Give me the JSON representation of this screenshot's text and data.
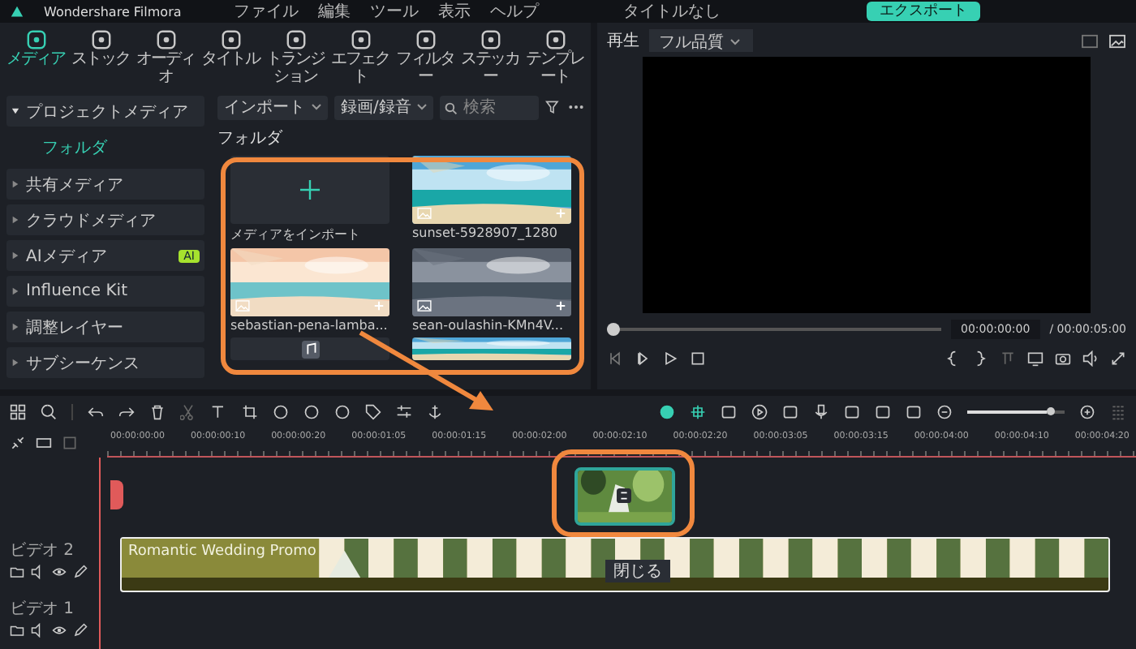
{
  "title_bar": {
    "app_title": "Wondershare Filmora",
    "menu": [
      "ファイル",
      "編集",
      "ツール",
      "表示",
      "ヘルプ"
    ],
    "project_title": "タイトルなし",
    "export_button": "エクスポート"
  },
  "media_tabs": [
    {
      "label": "メディア",
      "selected": true
    },
    {
      "label": "ストック",
      "selected": false
    },
    {
      "label": "オーディオ",
      "selected": false
    },
    {
      "label": "タイトル",
      "selected": false
    },
    {
      "label": "トランジション",
      "selected": false
    },
    {
      "label": "エフェクト",
      "selected": false
    },
    {
      "label": "フィルター",
      "selected": false
    },
    {
      "label": "ステッカー",
      "selected": false
    },
    {
      "label": "テンプレート",
      "selected": false
    }
  ],
  "sidebar": {
    "items": [
      {
        "label": "プロジェクトメディア",
        "expanded": true,
        "children": [
          {
            "label": "フォルダ",
            "selected": true
          }
        ]
      },
      {
        "label": "共有メディア",
        "expanded": false
      },
      {
        "label": "クラウドメディア",
        "expanded": false
      },
      {
        "label": "AIメディア",
        "expanded": false,
        "badge": "AI"
      },
      {
        "label": "Influence Kit",
        "expanded": false
      },
      {
        "label": "調整レイヤー",
        "expanded": false
      },
      {
        "label": "サブシーケンス",
        "expanded": false
      }
    ]
  },
  "media_toolbar": {
    "import_button": "インポート",
    "record_button": "録画/録音",
    "search": {
      "placeholder": "検索"
    }
  },
  "folder_label": "フォルダ",
  "media_items": [
    {
      "kind": "import",
      "label": "メディアをインポート"
    },
    {
      "kind": "picture",
      "label": "sunset-5928907_1280"
    },
    {
      "kind": "picture",
      "label": "sebastian-pena-lamba..."
    },
    {
      "kind": "picture",
      "label": "sean-oulashin-KMn4V..."
    },
    {
      "kind": "audio"
    },
    {
      "kind": "picture"
    }
  ],
  "preview": {
    "label": "再生",
    "quality": "フル品質",
    "level": 0,
    "current_time": "00:00:00:00",
    "total_time": "/ 00:00:05:00"
  },
  "timeline": {
    "zoom_slider": {
      "level": 0.82
    },
    "ruler": [
      "00:00:00:00",
      "00:00:00:10",
      "00:00:00:20",
      "00:00:01:05",
      "00:00:01:15",
      "00:00:02:00",
      "00:00:02:10",
      "00:00:02:20",
      "00:00:03:05",
      "00:00:03:15",
      "00:00:04:00",
      "00:00:04:10",
      "00:00:04:20"
    ],
    "tracks": [
      {
        "kind": "drop"
      },
      {
        "kind": "video",
        "label": "ビデオ 2",
        "clip": "Romantic Wedding Promo",
        "tooltip": "閉じる"
      },
      {
        "kind": "video",
        "label": "ビデオ 1"
      }
    ]
  }
}
